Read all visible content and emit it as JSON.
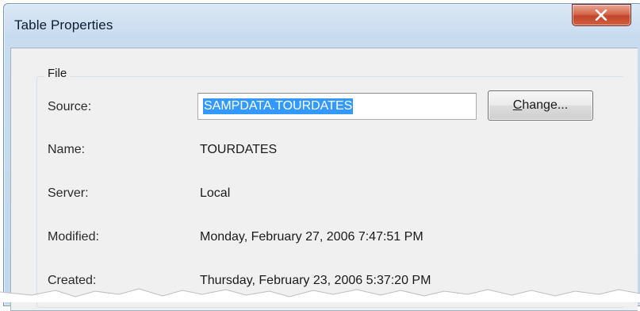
{
  "window": {
    "title": "Table Properties",
    "close_glyph": "X"
  },
  "group": {
    "label": "File"
  },
  "fields": {
    "source_label": "Source:",
    "source_value": "SAMPDATA.TOURDATES",
    "change_label_mnemonic": "C",
    "change_label_rest": "hange...",
    "name_label": "Name:",
    "name_value": "TOURDATES",
    "server_label": "Server:",
    "server_value": "Local",
    "modified_label": "Modified:",
    "modified_value": "Monday, February 27, 2006 7:47:51 PM",
    "created_label": "Created:",
    "created_value": "Thursday, February 23, 2006 5:37:20 PM"
  },
  "colors": {
    "selection": "#3399ff",
    "close_button": "#c1452b",
    "title_bar": "#c9dcef"
  },
  "icons": {
    "close": "close-icon"
  }
}
